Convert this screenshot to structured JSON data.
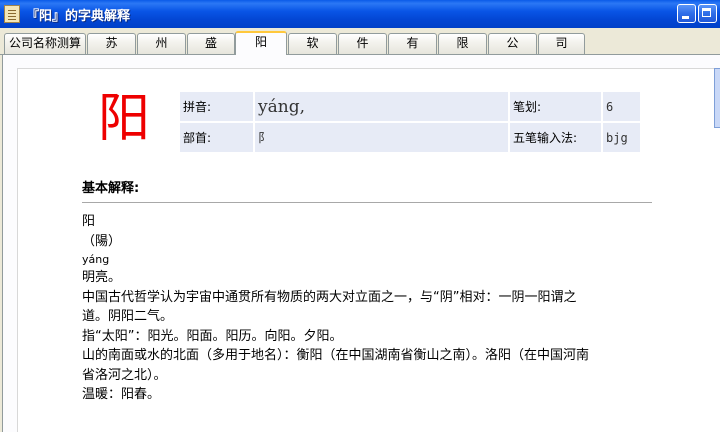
{
  "window": {
    "title": "『阳』的字典解释"
  },
  "tabs": [
    {
      "label": "公司名称测算",
      "active": false
    },
    {
      "label": "苏",
      "active": false
    },
    {
      "label": "州",
      "active": false
    },
    {
      "label": "盛",
      "active": false
    },
    {
      "label": "阳",
      "active": true
    },
    {
      "label": "软",
      "active": false
    },
    {
      "label": "件",
      "active": false
    },
    {
      "label": "有",
      "active": false
    },
    {
      "label": "限",
      "active": false
    },
    {
      "label": "公",
      "active": false
    },
    {
      "label": "司",
      "active": false
    }
  ],
  "entry": {
    "character": "阳",
    "pinyin_label": "拼音:",
    "pinyin": "yáng,",
    "strokes_label": "笔划:",
    "strokes": "6",
    "radical_label": "部首:",
    "radical": "阝",
    "wubi_label": "五笔输入法:",
    "wubi": "bjg"
  },
  "definition": {
    "heading": "基本解释:",
    "lines": [
      "阳",
      "（陽）",
      "yáng",
      "明亮。",
      "中国古代哲学认为宇宙中通贯所有物质的两大对立面之一，与“阴”相对：一阴一阳谓之",
      "道。阴阳二气。",
      "指“太阳”：阳光。阳面。阳历。向阳。夕阳。",
      "山的南面或水的北面（多用于地名）：衡阳（在中国湖南省衡山之南）。洛阳（在中国河南",
      "省洛河之北）。",
      "温暖：阳春。"
    ]
  },
  "colors": {
    "titlebar": "#0346d4",
    "character": "#ee0000",
    "info_cell_bg": "#e7ebf6",
    "active_tab_accent": "#ffc83c"
  }
}
